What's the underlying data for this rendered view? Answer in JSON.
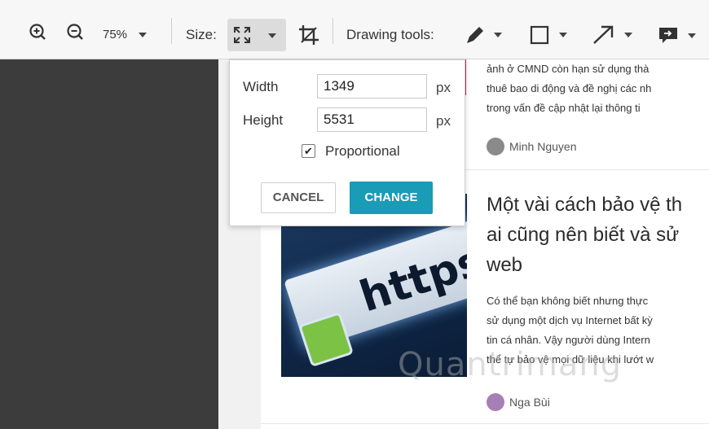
{
  "toolbar": {
    "zoom_value": "75%",
    "size_label": "Size:",
    "drawing_tools_label": "Drawing tools:"
  },
  "size_popup": {
    "width_label": "Width",
    "width_value": "1349",
    "height_label": "Height",
    "height_value": "5531",
    "unit": "px",
    "proportional_label": "Proportional",
    "proportional_checked": true,
    "cancel_label": "CANCEL",
    "change_label": "CHANGE"
  },
  "article": {
    "prev_snippet": [
      "ảnh ở CMND còn hạn sử dụng thà",
      "thuê bao di động và đề nghị các nh",
      "trong vấn đề cập nhật lại thông ti"
    ],
    "prev_author": "Minh Nguyen",
    "headline": [
      "Một vài cách bảo vệ th",
      "ai cũng nên biết và sử",
      "web"
    ],
    "thumbnail_text": "https",
    "body": [
      "Có thể bạn không biết nhưng thực",
      "sử dụng một dịch vụ Internet bất kỳ",
      "tin cá nhân. Vậy người dùng Intern",
      "thể tự bảo vệ mọi dữ liệu khi lướt w"
    ],
    "author": "Nga Bùi"
  },
  "watermark": "Quantrimang",
  "colors": {
    "accent": "#1a9bb6",
    "dark_bg": "#3c3c3c"
  }
}
